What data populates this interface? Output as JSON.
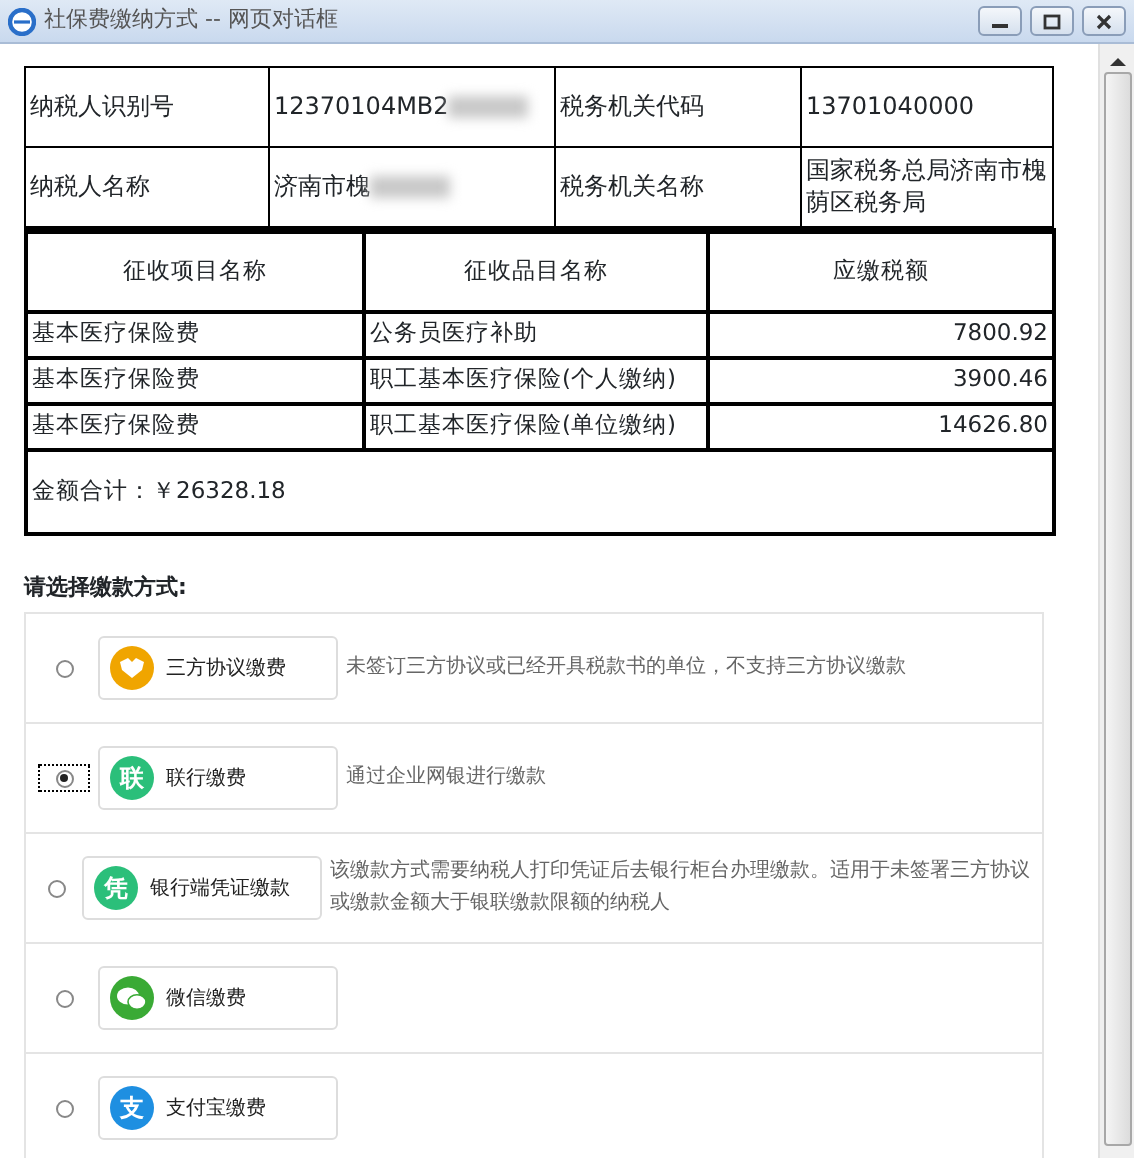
{
  "window": {
    "title": "社保费缴纳方式 -- 网页对话框"
  },
  "taxpayer_info": [
    {
      "fields": [
        {
          "label": "纳税人识别号",
          "value": "12370104MB2",
          "redacted": true
        },
        {
          "label": "税务机关代码",
          "value": "13701040000"
        }
      ]
    },
    {
      "fields": [
        {
          "label": "纳税人名称",
          "value": "济南市槐",
          "redacted": true
        },
        {
          "label": "税务机关名称",
          "value": "国家税务总局济南市槐荫区税务局"
        }
      ]
    }
  ],
  "items_table": {
    "columns": [
      "征收项目名称",
      "征收品目名称",
      "应缴税额"
    ],
    "rows": [
      [
        "基本医疗保险费",
        "公务员医疗补助",
        "7800.92"
      ],
      [
        "基本医疗保险费",
        "职工基本医疗保险(个人缴纳)",
        "3900.46"
      ],
      [
        "基本医疗保险费",
        "职工基本医疗保险(单位缴纳)",
        "14626.80"
      ]
    ],
    "total": "金额合计：￥26328.18"
  },
  "payment_prompt": "请选择缴款方式:",
  "payment_methods": [
    {
      "label": "三方协议缴费",
      "kind": "agreement",
      "color": "#f0a500",
      "description": "未签订三方协议或已经开具税款书的单位，不支持三方协议缴款",
      "selected": false
    },
    {
      "label": "联行缴费",
      "kind": "char",
      "icon_char": "联",
      "color": "#2bbf7a",
      "description": "通过企业网银进行缴款",
      "selected": true
    },
    {
      "label": "银行端凭证缴款",
      "kind": "char",
      "icon_char": "凭",
      "color": "#2bbf7a",
      "description": "该缴款方式需要纳税人打印凭证后去银行柜台办理缴款。适用于未签署三方协议或缴款金额大于银联缴款限额的纳税人",
      "selected": false
    },
    {
      "label": "微信缴费",
      "kind": "wechat",
      "color": "#3aaa35",
      "selected": false
    },
    {
      "label": "支付宝缴费",
      "kind": "char",
      "icon_char": "支",
      "color": "#1e8fe1",
      "selected": false
    }
  ]
}
